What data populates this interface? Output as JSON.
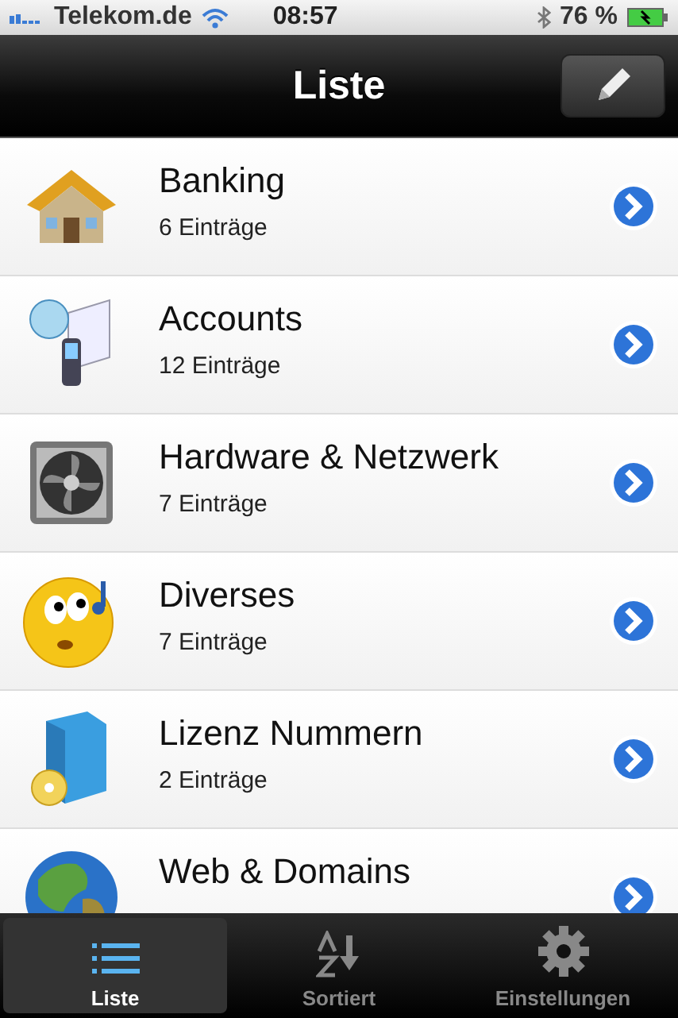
{
  "status_bar": {
    "carrier": "Telekom.de",
    "time": "08:57",
    "battery": "76 %"
  },
  "nav_bar": {
    "title": "Liste"
  },
  "items": [
    {
      "kind": "house",
      "title": "Banking",
      "subtitle": "6 Einträge"
    },
    {
      "kind": "phone",
      "title": "Accounts",
      "subtitle": "12 Einträge"
    },
    {
      "kind": "fan",
      "title": "Hardware & Netzwerk",
      "subtitle": "7 Einträge"
    },
    {
      "kind": "face",
      "title": "Diverses",
      "subtitle": "7 Einträge"
    },
    {
      "kind": "box",
      "title": "Lizenz Nummern",
      "subtitle": "2 Einträge"
    },
    {
      "kind": "globe",
      "title": "Web & Domains"
    }
  ],
  "tab_bar": [
    {
      "kind": "list",
      "label": "Liste",
      "selected": true
    },
    {
      "kind": "sort",
      "label": "Sortiert",
      "selected": false
    },
    {
      "kind": "gear",
      "label": "Einstellungen",
      "selected": false
    }
  ]
}
